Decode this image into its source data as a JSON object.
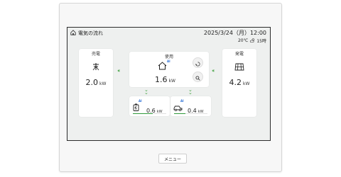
{
  "header": {
    "title": "電気の流れ",
    "datetime": "2025/3/24（月）12:00",
    "temperature": "20℃",
    "weather_value": "15時"
  },
  "sell": {
    "label": "売電",
    "value": "2.0",
    "unit": "kW"
  },
  "generation": {
    "label": "発電",
    "value": "4.2",
    "unit": "kW"
  },
  "usage": {
    "label": "使用",
    "value": "1.6",
    "unit": "kW",
    "ai": "AI"
  },
  "devices": [
    {
      "value": "0.6",
      "unit": "kW",
      "ai": "AI",
      "level": 0.6,
      "icon": "battery-icon"
    },
    {
      "value": "0.4",
      "unit": "kW",
      "ai": "AI",
      "level": 0.35,
      "icon": "ev-car-icon"
    }
  ],
  "menu": {
    "label": "メニュー"
  },
  "colors": {
    "accent": "#2f9a3a",
    "ai": "#2a6fd6"
  }
}
